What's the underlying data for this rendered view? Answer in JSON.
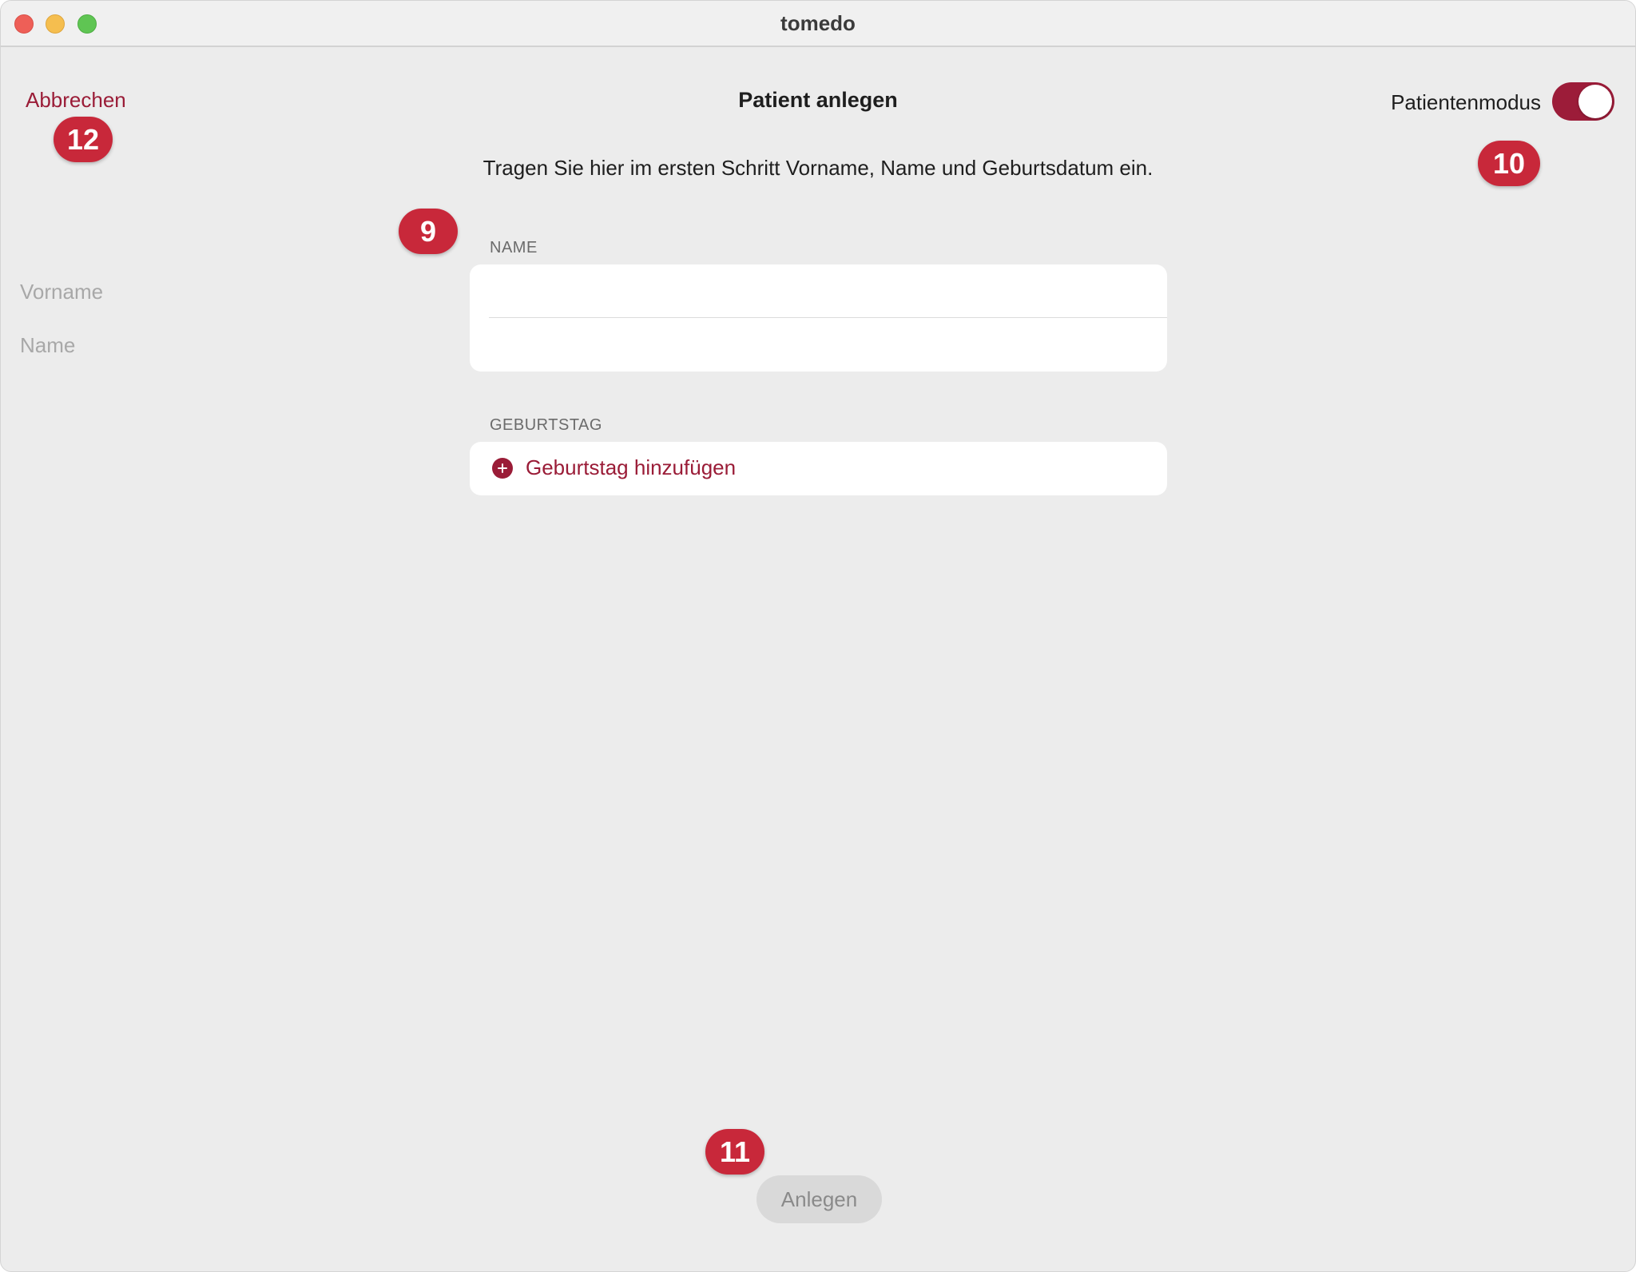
{
  "window": {
    "title": "tomedo"
  },
  "header": {
    "cancel_label": "Abbrechen",
    "page_title": "Patient anlegen",
    "mode_label": "Patientenmodus",
    "mode_enabled": true
  },
  "instruction": "Tragen Sie hier im ersten Schritt Vorname, Name und Geburtsdatum ein.",
  "name_section": {
    "label": "NAME",
    "first_name": {
      "value": "",
      "placeholder": "Vorname"
    },
    "last_name": {
      "value": "",
      "placeholder": "Name"
    }
  },
  "birthday_section": {
    "label": "GEBURTSTAG",
    "add_label": "Geburtstag hinzufügen"
  },
  "footer": {
    "create_label": "Anlegen",
    "create_enabled": false
  },
  "badges": {
    "cancel": "12",
    "mode": "10",
    "name": "9",
    "create": "11"
  },
  "colors": {
    "accent": "#9a1c37",
    "badge": "#c8283a",
    "window_bg": "#ececec",
    "card_bg": "#ffffff"
  },
  "icons": {
    "add": "plus-circle-icon"
  }
}
